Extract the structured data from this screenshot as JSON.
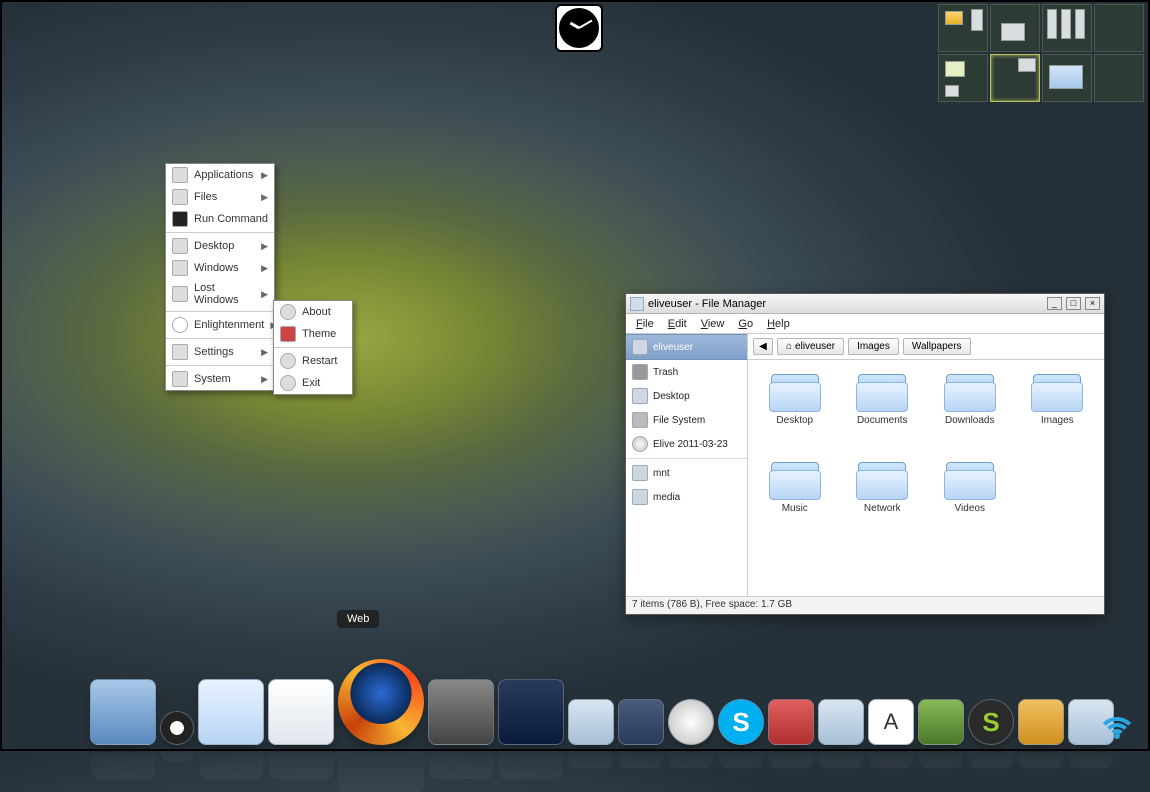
{
  "clock": {
    "name": "analog-clock"
  },
  "pager": {
    "rows": 2,
    "cols": 4,
    "active": 5
  },
  "context_menu": {
    "main": [
      {
        "label": "Applications",
        "icon": "play-icon",
        "submenu": true
      },
      {
        "label": "Files",
        "icon": "files-icon",
        "submenu": true
      },
      {
        "label": "Run Command",
        "icon": "terminal-icon",
        "submenu": false
      },
      {
        "sep": true
      },
      {
        "label": "Desktop",
        "icon": "desktop-icon",
        "submenu": true
      },
      {
        "label": "Windows",
        "icon": "windows-icon",
        "submenu": true
      },
      {
        "label": "Lost Windows",
        "icon": "help-icon",
        "submenu": true
      },
      {
        "sep": true
      },
      {
        "label": "Enlightenment",
        "icon": "e-icon",
        "submenu": true
      },
      {
        "sep": true
      },
      {
        "label": "Settings",
        "icon": "settings-icon",
        "submenu": true
      },
      {
        "sep": true
      },
      {
        "label": "System",
        "icon": "system-icon",
        "submenu": true
      }
    ],
    "sub": [
      {
        "label": "About",
        "icon": "about-icon"
      },
      {
        "label": "Theme",
        "icon": "theme-icon"
      },
      {
        "sep": true
      },
      {
        "label": "Restart",
        "icon": "restart-icon"
      },
      {
        "label": "Exit",
        "icon": "exit-icon"
      }
    ]
  },
  "file_manager": {
    "title": "eliveuser - File Manager",
    "menubar": [
      "File",
      "Edit",
      "View",
      "Go",
      "Help"
    ],
    "sidebar": [
      {
        "label": "eliveuser",
        "icon": "home-icon",
        "selected": true
      },
      {
        "label": "Trash",
        "icon": "trash-icon"
      },
      {
        "label": "Desktop",
        "icon": "desktop-icon"
      },
      {
        "label": "File System",
        "icon": "drive-icon"
      },
      {
        "label": "Elive 2011-03-23",
        "icon": "disc-icon"
      },
      {
        "sep": true
      },
      {
        "label": "mnt",
        "icon": "folder-icon"
      },
      {
        "label": "media",
        "icon": "folder-icon"
      }
    ],
    "breadcrumbs": {
      "back": "◀",
      "items": [
        "eliveuser",
        "Images",
        "Wallpapers"
      ]
    },
    "contents": [
      {
        "label": "Desktop"
      },
      {
        "label": "Documents"
      },
      {
        "label": "Downloads"
      },
      {
        "label": "Images"
      },
      {
        "label": "Music"
      },
      {
        "label": "Network"
      },
      {
        "label": "Videos"
      }
    ],
    "status": "7 items (786 B), Free space: 1.7 GB",
    "window_controls": {
      "min": "_",
      "max": "□",
      "close": "×"
    }
  },
  "dock": {
    "tooltip": "Web",
    "items": [
      {
        "name": "monitor-app",
        "size": "mid"
      },
      {
        "name": "penguin-app",
        "size": "norm"
      },
      {
        "name": "folder-home",
        "size": "mid"
      },
      {
        "name": "notes-app",
        "size": "mid"
      },
      {
        "name": "firefox",
        "size": "big",
        "class": "ff"
      },
      {
        "name": "camera-app",
        "size": "mid"
      },
      {
        "name": "photo-app",
        "size": "mid"
      },
      {
        "name": "search-app",
        "size": "norm"
      },
      {
        "name": "video-app",
        "size": "norm"
      },
      {
        "name": "music-app",
        "size": "norm"
      },
      {
        "name": "skype",
        "size": "norm"
      },
      {
        "name": "download-app",
        "size": "norm"
      },
      {
        "name": "gallery-app",
        "size": "norm"
      },
      {
        "name": "text-app",
        "size": "norm"
      },
      {
        "name": "tree-app",
        "size": "norm"
      },
      {
        "name": "s-app",
        "size": "norm"
      },
      {
        "name": "package-app",
        "size": "norm"
      },
      {
        "name": "elive-app",
        "size": "norm"
      }
    ]
  },
  "tray": {
    "wifi": "wifi-connected"
  }
}
